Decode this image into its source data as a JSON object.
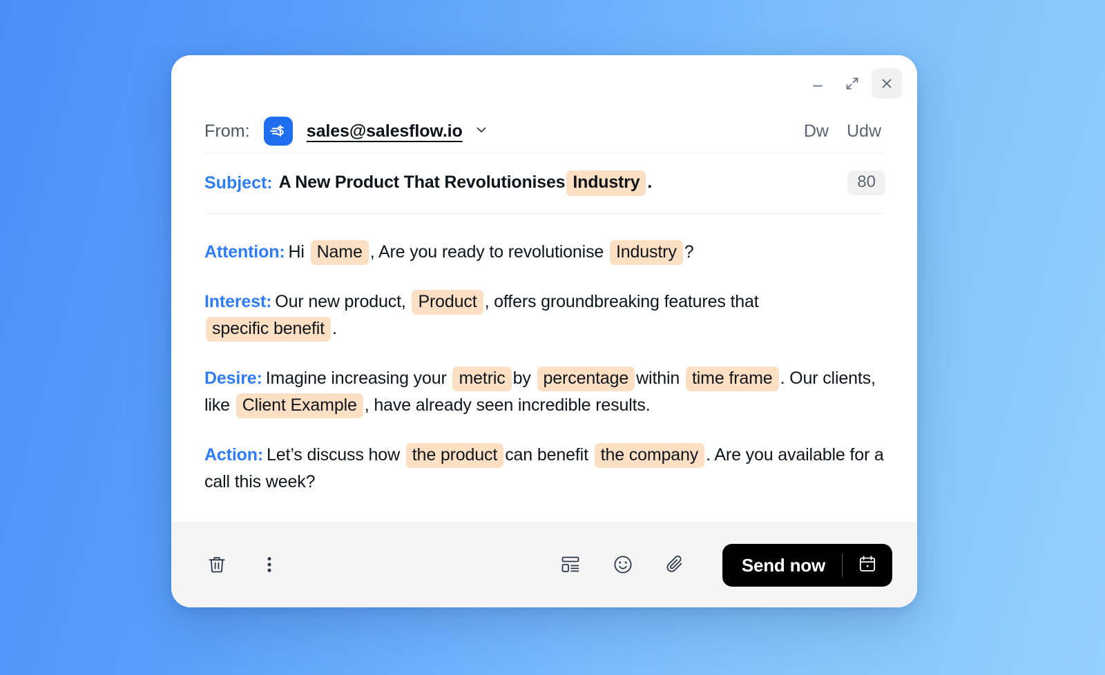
{
  "window": {
    "minimize_label": "Minimize",
    "expand_label": "Expand",
    "close_label": "Close"
  },
  "from": {
    "label": "From:",
    "logo_alt": "salesflow-logo",
    "email": "sales@salesflow.io",
    "dropdown_icon": "chevron-down-icon",
    "cc_label": "Dw",
    "bcc_label": "Udw"
  },
  "subject": {
    "label": "Subject:",
    "text_before": "A New Product That Revolutionises",
    "tag": "Industry",
    "text_after": ".",
    "char_count": "80"
  },
  "body": {
    "attention": {
      "label": "Attention:",
      "seg1": "Hi",
      "tag1": "Name",
      "seg2": ", Are you ready to revolutionise",
      "tag2": "Industry",
      "seg3": "?"
    },
    "interest": {
      "label": "Interest:",
      "seg1": "Our new product,",
      "tag1": "Product",
      "seg2": ", offers groundbreaking features that",
      "tag2": "specific benefit",
      "seg3": "."
    },
    "desire": {
      "label": "Desire:",
      "seg1": "Imagine increasing your",
      "tag1": "metric",
      "seg2": "by",
      "tag2": "percentage",
      "seg3": "within",
      "tag3": "time frame",
      "seg4": ". Our clients, like",
      "tag4": "Client Example",
      "seg5": ", have already seen incredible results."
    },
    "action": {
      "label": "Action:",
      "seg1": "Let’s discuss how",
      "tag1": "the product",
      "seg2": "can benefit",
      "tag2": "the company",
      "seg3": ". Are you available for a call this week?"
    }
  },
  "footer": {
    "delete_icon": "trash-icon",
    "more_icon": "more-vertical-icon",
    "template_icon": "template-icon",
    "emoji_icon": "smiley-icon",
    "attach_icon": "paperclip-icon",
    "send_label": "Send now",
    "schedule_icon": "calendar-icon"
  },
  "colors": {
    "accent_blue": "#2f7cf6",
    "logo_blue": "#1f6ef0",
    "tag_peach": "#fde0c4",
    "send_black": "#000000",
    "footer_gray": "#f5f5f6",
    "bg_gradient_start": "#4a8ef8",
    "bg_gradient_end": "#95d0fc"
  }
}
